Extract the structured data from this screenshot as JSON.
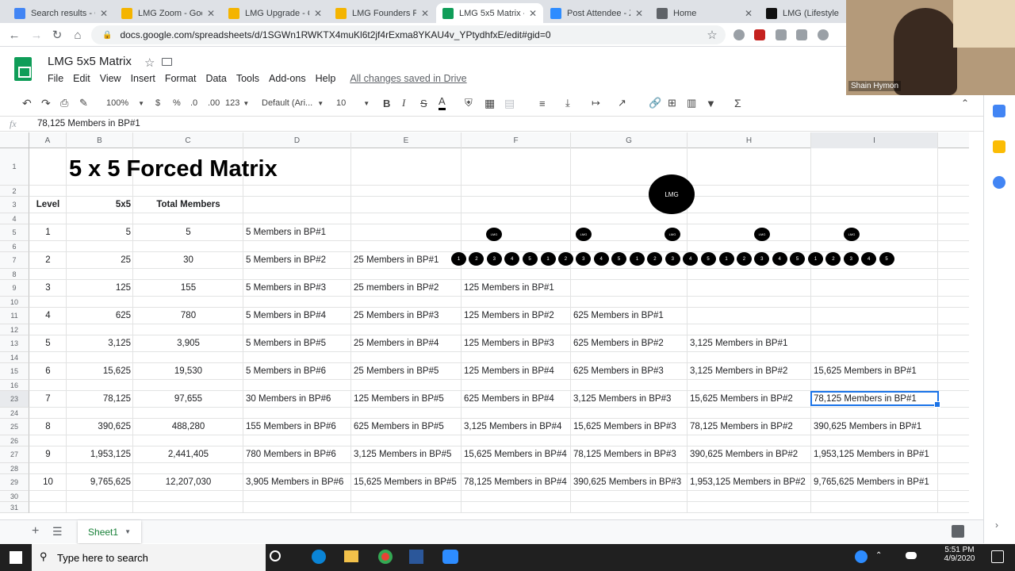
{
  "browser": {
    "tabs": [
      {
        "title": "Search results - Go",
        "color": "#4285f4",
        "active": false
      },
      {
        "title": "LMG Zoom - Goog",
        "color": "#f4b400",
        "active": false
      },
      {
        "title": "LMG Upgrade - Go",
        "color": "#f4b400",
        "active": false
      },
      {
        "title": "LMG Founders Pre",
        "color": "#f4b400",
        "active": false
      },
      {
        "title": "LMG 5x5 Matrix - G",
        "color": "#0f9d58",
        "active": true
      },
      {
        "title": "Post Attendee - Zo",
        "color": "#2d8cff",
        "active": false
      },
      {
        "title": "Home",
        "color": "#5f6368",
        "active": false
      },
      {
        "title": "LMG (Lifestyle Ma",
        "color": "#111111",
        "active": false
      }
    ],
    "url": "docs.google.com/spreadsheets/d/1SGWn1RWKTX4muKl6t2jf4rExma8YKAU4v_YPtydhfxE/edit#gid=0"
  },
  "doc": {
    "title": "LMG 5x5 Matrix",
    "menu": [
      "File",
      "Edit",
      "View",
      "Insert",
      "Format",
      "Data",
      "Tools",
      "Add-ons",
      "Help"
    ],
    "saved": "All changes saved in Drive"
  },
  "toolbar": {
    "zoom": "100%",
    "currency": "$",
    "percent": "%",
    "dec_less": ".0",
    "dec_more": ".00",
    "num_format": "123",
    "font": "Default (Ari...",
    "size": "10"
  },
  "formula": {
    "fx": "fx",
    "value": "78,125 Members in BP#1"
  },
  "grid": {
    "columns": [
      "A",
      "B",
      "C",
      "D",
      "E",
      "F",
      "G",
      "H",
      "I"
    ],
    "row_numbers": [
      "1",
      "2",
      "3",
      "4",
      "5",
      "6",
      "7",
      "8",
      "9",
      "10",
      "11",
      "12",
      "13",
      "14",
      "15",
      "16",
      "23",
      "24",
      "25",
      "26",
      "27",
      "28",
      "29",
      "30",
      "31"
    ],
    "title": "5 x 5 Forced Matrix",
    "headers": {
      "level": "Level",
      "matrix": "5x5",
      "total": "Total Members"
    },
    "rows": [
      {
        "level": "1",
        "members": "5",
        "total": "5",
        "cols": [
          "5 Members in BP#1",
          "",
          "",
          "",
          "",
          ""
        ]
      },
      {
        "level": "2",
        "members": "25",
        "total": "30",
        "cols": [
          "5 Members in BP#2",
          "25 Members in BP#1",
          "",
          "",
          "",
          ""
        ]
      },
      {
        "level": "3",
        "members": "125",
        "total": "155",
        "cols": [
          "5 Members in BP#3",
          "25 members in BP#2",
          "125 Members in BP#1",
          "",
          "",
          ""
        ]
      },
      {
        "level": "4",
        "members": "625",
        "total": "780",
        "cols": [
          "5 Members in BP#4",
          "25 Members in BP#3",
          "125 Members in BP#2",
          "625 Members in BP#1",
          "",
          ""
        ]
      },
      {
        "level": "5",
        "members": "3,125",
        "total": "3,905",
        "cols": [
          "5 Members in BP#5",
          "25 Members in BP#4",
          "125 Members in BP#3",
          "625 Members in BP#2",
          "3,125 Members in BP#1",
          ""
        ]
      },
      {
        "level": "6",
        "members": "15,625",
        "total": "19,530",
        "cols": [
          "5 Members in BP#6",
          "25 Members in BP#5",
          "125 Members in BP#4",
          "625 Members in BP#3",
          "3,125 Members in BP#2",
          "15,625 Members in BP#1"
        ]
      },
      {
        "level": "7",
        "members": "78,125",
        "total": "97,655",
        "cols": [
          "30 Members in BP#6",
          "125 Members in BP#5",
          "625 Members in BP#4",
          "3,125 Members in BP#3",
          "15,625 Members in BP#2",
          "78,125 Members in BP#1"
        ]
      },
      {
        "level": "8",
        "members": "390,625",
        "total": "488,280",
        "cols": [
          "155 Members in BP#6",
          "625 Members in BP#5",
          "3,125 Members in BP#4",
          "15,625 Members in BP#3",
          "78,125 Members in BP#2",
          "390,625 Members in BP#1"
        ]
      },
      {
        "level": "9",
        "members": "1,953,125",
        "total": "2,441,405",
        "cols": [
          "780 Members in BP#6",
          "3,125 Members in BP#5",
          "15,625 Members in BP#4",
          "78,125 Members in BP#3",
          "390,625 Members in BP#2",
          "1,953,125 Members in BP#1"
        ]
      },
      {
        "level": "10",
        "members": "9,765,625",
        "total": "12,207,030",
        "cols": [
          "3,905 Members in BP#6",
          "15,625 Members in BP#5",
          "78,125 Members in BP#4",
          "390,625 Members in BP#3",
          "1,953,125 Members in BP#2",
          "9,765,625 Members in BP#1"
        ]
      }
    ]
  },
  "matrix": {
    "root": "LMG",
    "level1": [
      "LMG",
      "LMG",
      "LMG",
      "LMG",
      "LMG"
    ],
    "level2": [
      "1",
      "2",
      "3",
      "4",
      "5"
    ]
  },
  "sheet": {
    "tab": "Sheet1"
  },
  "webcam": {
    "name": "Shain Hymon"
  },
  "taskbar": {
    "search_placeholder": "Type here to search",
    "time": "5:51 PM",
    "date": "4/9/2020"
  }
}
